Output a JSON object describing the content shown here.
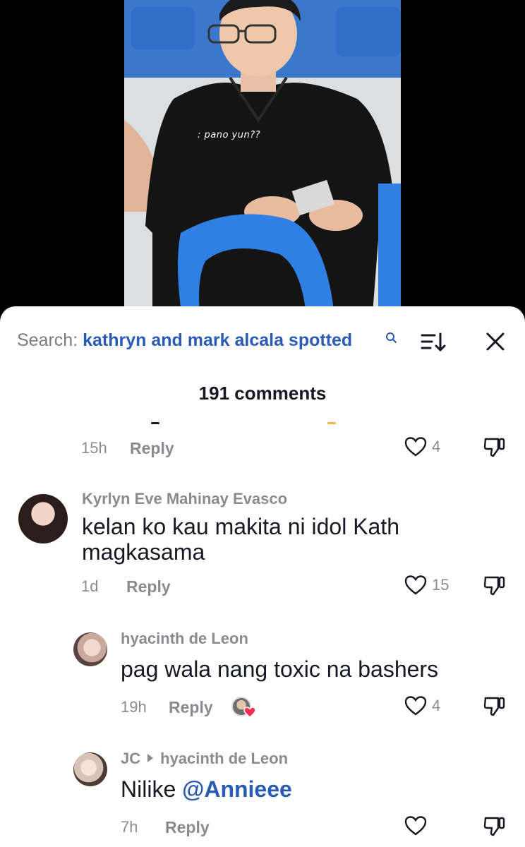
{
  "video": {
    "caption": ": pano yun??"
  },
  "search": {
    "prefix": "Search:",
    "query": "kathryn and mark alcala spotted",
    "search_icon": "search-icon",
    "sort_icon": "sort-icon",
    "close_icon": "close-icon"
  },
  "comments_count": "191 comments",
  "comments": [
    {
      "time": "15h",
      "reply_label": "Reply",
      "likes": "4"
    },
    {
      "author": "Kyrlyn Eve Mahinay Evasco",
      "text": "kelan ko kau makita ni idol Kath magkasama",
      "time": "1d",
      "reply_label": "Reply",
      "likes": "15"
    },
    {
      "author": "hyacinth de Leon",
      "text": "pag wala nang toxic na bashers",
      "time": "19h",
      "reply_label": "Reply",
      "likes": "4",
      "liked_by_creator": true
    },
    {
      "author": "JC",
      "reply_to": "hyacinth de Leon",
      "text_prefix": "Nilike",
      "mention": "@Annieee",
      "time": "7h",
      "reply_label": "Reply",
      "likes": ""
    }
  ],
  "colors": {
    "accent": "#2a5bb4",
    "muted": "#8a8b91",
    "text": "#161823",
    "like_heart": "#fe2c55"
  }
}
